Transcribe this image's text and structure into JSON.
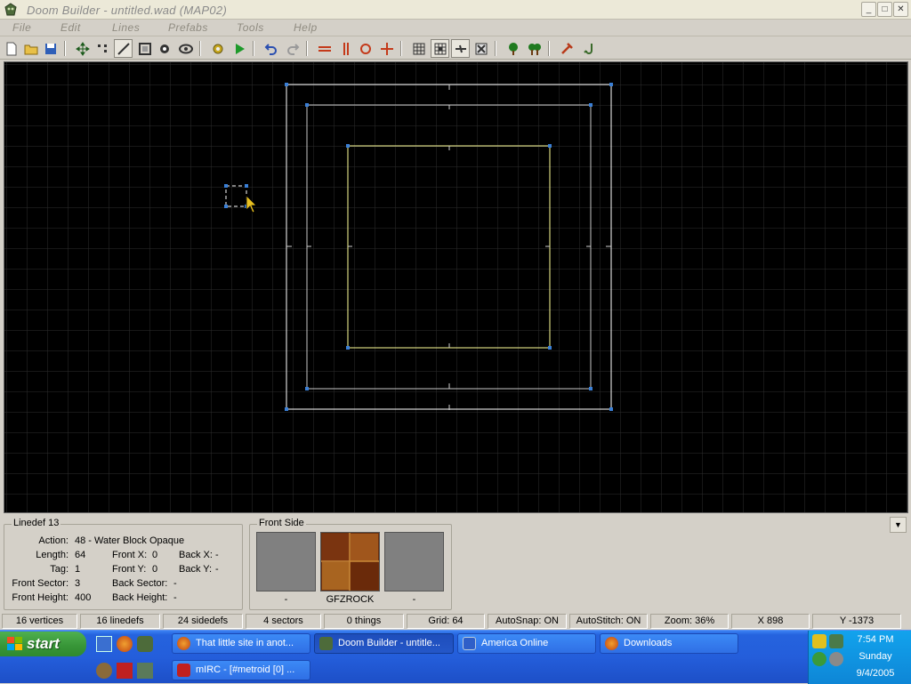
{
  "window": {
    "title": "Doom Builder - untitled.wad (MAP02)",
    "buttons": {
      "minimize": "_",
      "maximize": "□",
      "close": "✕"
    }
  },
  "menu": [
    "File",
    "Edit",
    "Lines",
    "Prefabs",
    "Tools",
    "Help"
  ],
  "toolbar": {
    "icons": [
      "new-map-icon",
      "open-icon",
      "save-icon",
      "move-mode-icon",
      "vertex-mode-icon",
      "lines-mode-icon",
      "sectors-mode-icon",
      "things-mode-icon",
      "3d-mode-icon",
      "test-map-settings-icon",
      "test-map-icon",
      "undo-icon",
      "redo-icon",
      "flip-lines-icon",
      "flip-vertical-icon",
      "rotate-icon",
      "scale-icon",
      "grid-icon",
      "snap-grid-icon",
      "stitch-icon",
      "zoom-fit-icon",
      "tree-icon",
      "trees-icon",
      "hammer-icon",
      "check-icon"
    ]
  },
  "map": {
    "background": "#000000",
    "grid_color": "#2e2e2e",
    "line_color_white": "#ffffff",
    "line_color_gray": "#c8c8c8",
    "line_color_yellow": "#ffff99",
    "vertex_color": "#3a7fd6"
  },
  "info": {
    "linedef": {
      "title": "Linedef 13",
      "action_label": "Action:",
      "action": "48 - Water Block Opaque",
      "length_label": "Length:",
      "length": "64",
      "tag_label": "Tag:",
      "tag": "1",
      "front_sector_label": "Front Sector:",
      "front_sector": "3",
      "front_height_label": "Front Height:",
      "front_height": "400",
      "front_x_label": "Front X:",
      "front_x": "0",
      "front_y_label": "Front Y:",
      "front_y": "0",
      "back_sector_label": "Back Sector:",
      "back_sector": "-",
      "back_height_label": "Back Height:",
      "back_height": "-",
      "back_x_label": "Back X:",
      "back_x": "-",
      "back_y_label": "Back Y:",
      "back_y": "-"
    },
    "front_side": {
      "title": "Front Side",
      "upper": "-",
      "middle": "GFZROCK",
      "lower": "-"
    }
  },
  "status": {
    "vertices": "16 vertices",
    "linedefs": "16 linedefs",
    "sidedefs": "24 sidedefs",
    "sectors": "4 sectors",
    "things": "0 things",
    "grid": "Grid: 64",
    "autosnap": "AutoSnap: ON",
    "autostitch": "AutoStitch: ON",
    "zoom": "Zoom: 36%",
    "x": "X 898",
    "y": "Y -1373"
  },
  "taskbar": {
    "start": "start",
    "tasks": [
      {
        "label": "That little site in anot...",
        "active": false
      },
      {
        "label": "Doom Builder - untitle...",
        "active": true
      },
      {
        "label": "America  Online",
        "active": false
      },
      {
        "label": "Downloads",
        "active": false
      },
      {
        "label": "mIRC - [#metroid [0] ...",
        "active": false
      }
    ],
    "clock": {
      "time": "7:54 PM",
      "day": "Sunday",
      "date": "9/4/2005"
    }
  }
}
